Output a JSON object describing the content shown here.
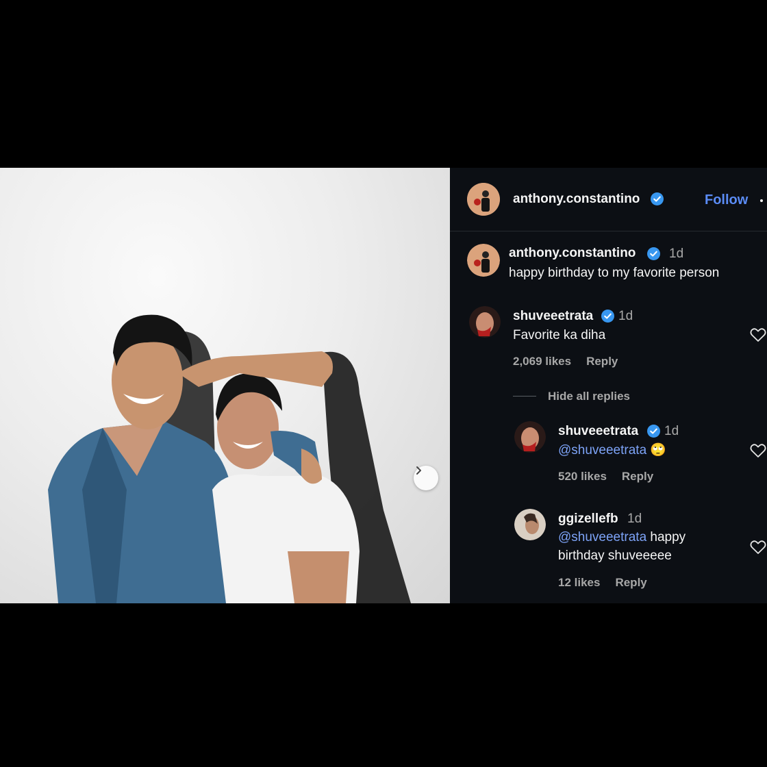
{
  "post": {
    "author": "anthony.constantino",
    "follow_label": "Follow",
    "caption": {
      "username": "anthony.constantino",
      "time": "1d",
      "text": "happy birthday to my favorite person"
    },
    "comments": [
      {
        "username": "shuveeetrata",
        "time": "1d",
        "text": "Favorite ka diha",
        "likes": "2,069 likes",
        "reply_label": "Reply"
      }
    ],
    "hide_replies_label": "Hide all replies",
    "replies": [
      {
        "username": "shuveeetrata",
        "time": "1d",
        "mention": "@shuveeetrata",
        "text": "🙄",
        "likes": "520 likes",
        "reply_label": "Reply"
      },
      {
        "username": "ggizellefb",
        "time": "1d",
        "mention": "@shuveeetrata",
        "text_line1": " happy",
        "text_line2": "birthday shuveeeee",
        "likes": "12 likes",
        "reply_label": "Reply"
      }
    ]
  },
  "colors": {
    "background": "#000000",
    "panel": "#0c0f14",
    "accent_link": "#5b8cf6",
    "verified": "#3897f0",
    "muted": "#a8a8a8"
  },
  "icons": [
    "verified-badge-icon",
    "heart-icon",
    "chevron-right-icon",
    "more-options-icon"
  ]
}
